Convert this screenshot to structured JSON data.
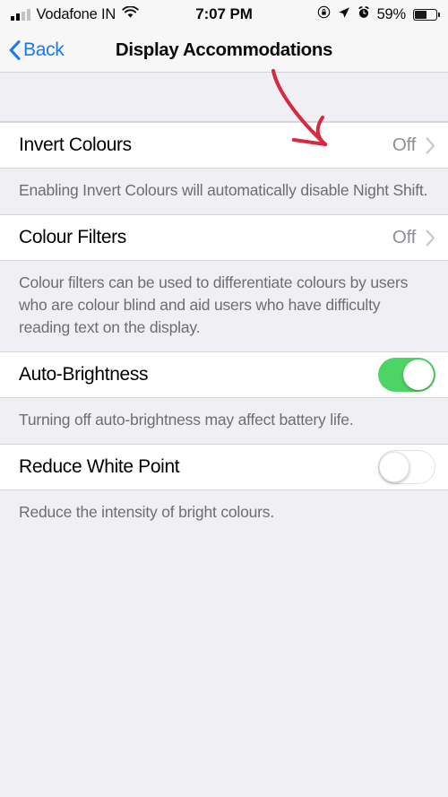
{
  "status_bar": {
    "carrier": "Vodafone IN",
    "wifi_icon": "wifi-icon",
    "signal_icon": "signal-bars-icon",
    "signal_bars_filled": 2,
    "signal_bars_total": 4,
    "time": "7:07 PM",
    "rotation_lock_icon": "rotation-lock-icon",
    "location_icon": "location-arrow-icon",
    "alarm_icon": "alarm-clock-icon",
    "battery_percent": "59%",
    "battery_icon": "battery-icon",
    "battery_level": 59
  },
  "nav_bar": {
    "back_label": "Back",
    "back_icon": "chevron-left-icon",
    "title": "Display Accommodations",
    "tint_color": "#1778F2"
  },
  "settings": {
    "sections": [
      {
        "row": {
          "title": "Invert Colours",
          "type": "disclosure",
          "value": "Off",
          "chevron_icon": "chevron-right-icon"
        },
        "footer": "Enabling Invert Colours will automatically disable Night Shift."
      },
      {
        "row": {
          "title": "Colour Filters",
          "type": "disclosure",
          "value": "Off",
          "chevron_icon": "chevron-right-icon"
        },
        "footer": "Colour filters can be used to differentiate colours by users who are colour blind and aid users who have difficulty reading text on the display."
      },
      {
        "row": {
          "title": "Auto-Brightness",
          "type": "switch",
          "switch_state": "on",
          "switch_on_color": "#4CD464"
        },
        "footer": "Turning off auto-brightness may affect battery life."
      },
      {
        "row": {
          "title": "Reduce White Point",
          "type": "switch",
          "switch_state": "off"
        },
        "footer": "Reduce the intensity of bright colours."
      }
    ]
  },
  "annotation": {
    "type": "arrow",
    "color": "#D9293E",
    "points_to": "Invert Colours row value",
    "description": "Hand-drawn red arrow pointing down-right to the Off value of the Invert Colours row"
  }
}
